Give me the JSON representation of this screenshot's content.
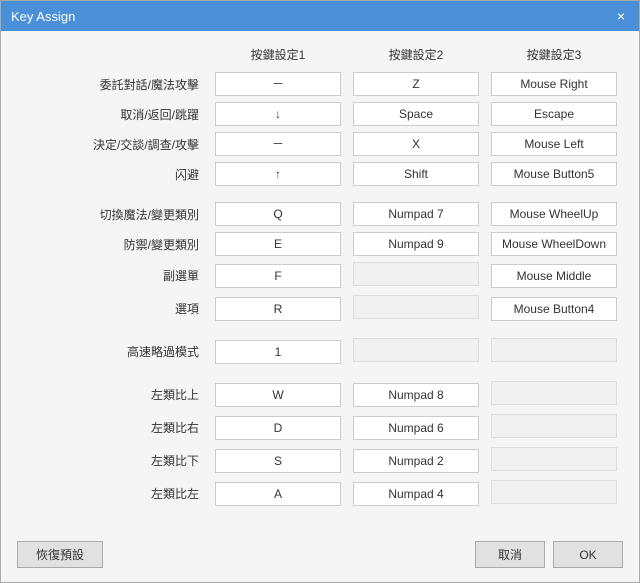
{
  "window": {
    "title": "Key Assign",
    "close_label": "×"
  },
  "table": {
    "headers": [
      "",
      "按鍵設定1",
      "按鍵設定2",
      "按鍵設定3"
    ],
    "rows": [
      {
        "label": "委託對話/魔法攻擊",
        "col1": "－",
        "col2": "Z",
        "col3": "Mouse Right"
      },
      {
        "label": "取消/返回/跳躍",
        "col1": "↓",
        "col2": "Space",
        "col3": "Escape"
      },
      {
        "label": "決定/交談/調查/攻擊",
        "col1": "－",
        "col2": "X",
        "col3": "Mouse Left"
      },
      {
        "label": "闪避",
        "col1": "↑",
        "col2": "Shift",
        "col3": "Mouse Button5"
      },
      {
        "label": "切換魔法/變更類別",
        "col1": "Q",
        "col2": "Numpad 7",
        "col3": "Mouse WheelUp"
      },
      {
        "label": "防禦/變更類別",
        "col1": "E",
        "col2": "Numpad 9",
        "col3": "Mouse WheelDown"
      },
      {
        "label": "副選單",
        "col1": "F",
        "col2": "",
        "col3": "Mouse Middle"
      },
      {
        "label": "選項",
        "col1": "R",
        "col2": "",
        "col3": "Mouse Button4"
      },
      {
        "label": "高速略過模式",
        "col1": "1",
        "col2": "",
        "col3": ""
      },
      {
        "label": "左類比上",
        "col1": "W",
        "col2": "Numpad 8",
        "col3": ""
      },
      {
        "label": "左類比右",
        "col1": "D",
        "col2": "Numpad 6",
        "col3": ""
      },
      {
        "label": "左類比下",
        "col1": "S",
        "col2": "Numpad 2",
        "col3": ""
      },
      {
        "label": "左類比左",
        "col1": "A",
        "col2": "Numpad 4",
        "col3": ""
      }
    ]
  },
  "footer": {
    "restore_label": "恢復預設",
    "cancel_label": "取消",
    "ok_label": "OK"
  }
}
